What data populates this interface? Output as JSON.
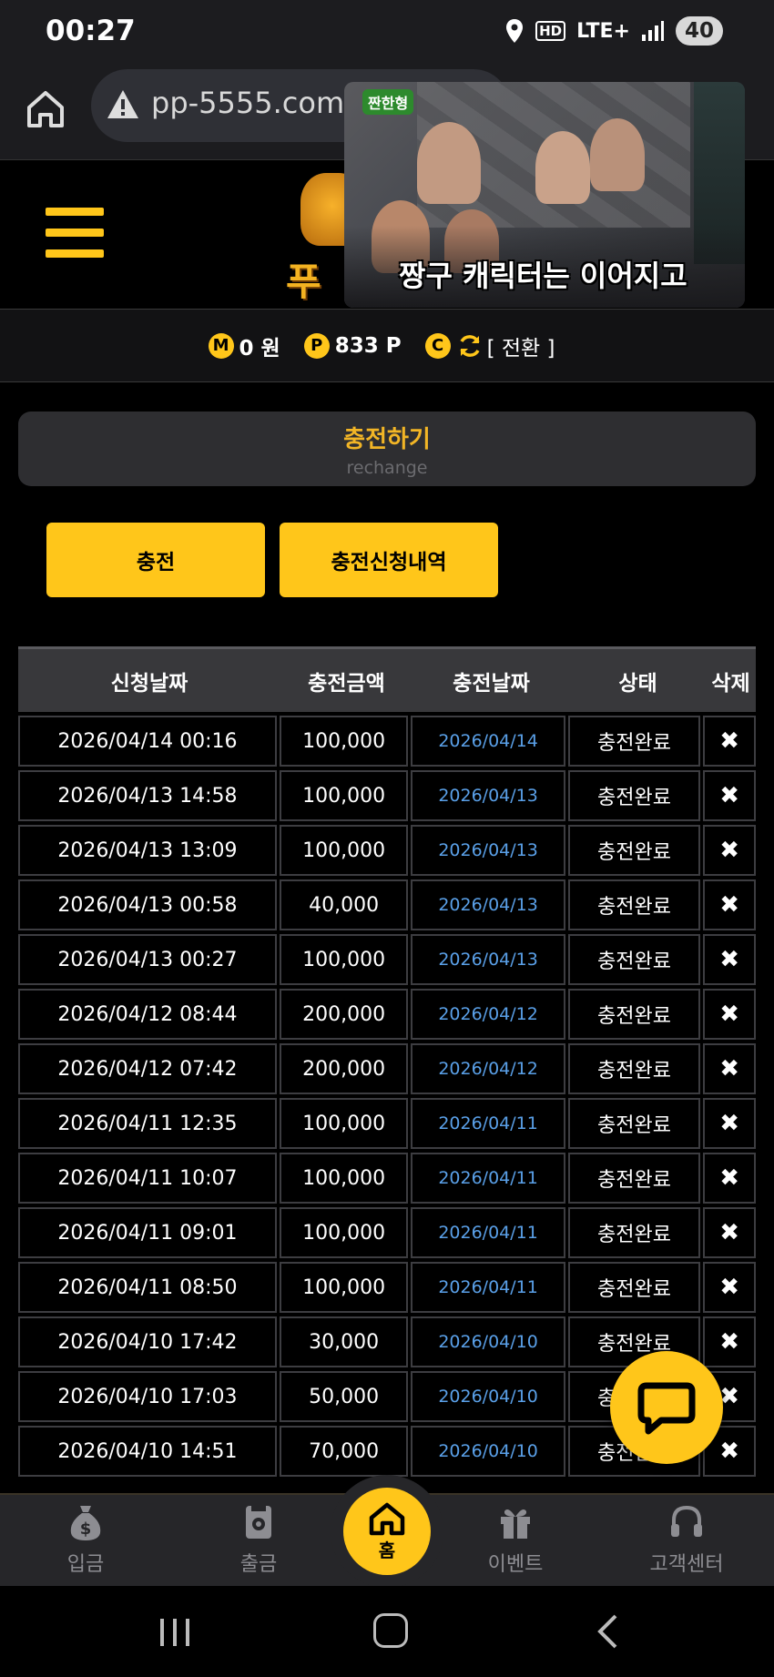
{
  "statusbar": {
    "time": "00:27",
    "network": "LTE+",
    "battery": "40"
  },
  "browser": {
    "url": "pp-5555.com/c"
  },
  "video": {
    "badge": "짠한형",
    "caption": "짱구 캐릭터는 이어지고"
  },
  "logo": {
    "text": "푸우"
  },
  "balance": {
    "money_icon": "M",
    "money": "0 원",
    "point_icon": "P",
    "points": "833 P",
    "coupon_icon": "C",
    "convert_label": "[ 전환 ]"
  },
  "section": {
    "title": "충전하기",
    "subtitle": "rechange"
  },
  "buttons": {
    "charge": "충전",
    "history": "충전신청내역"
  },
  "table": {
    "headers": [
      "신청날짜",
      "충전금액",
      "충전날짜",
      "상태",
      "삭제"
    ],
    "rows": [
      [
        "2026/04/14 00:16",
        "100,000",
        "2026/04/14",
        "충전완료",
        "✖"
      ],
      [
        "2026/04/13 14:58",
        "100,000",
        "2026/04/13",
        "충전완료",
        "✖"
      ],
      [
        "2026/04/13 13:09",
        "100,000",
        "2026/04/13",
        "충전완료",
        "✖"
      ],
      [
        "2026/04/13 00:58",
        "40,000",
        "2026/04/13",
        "충전완료",
        "✖"
      ],
      [
        "2026/04/13 00:27",
        "100,000",
        "2026/04/13",
        "충전완료",
        "✖"
      ],
      [
        "2026/04/12 08:44",
        "200,000",
        "2026/04/12",
        "충전완료",
        "✖"
      ],
      [
        "2026/04/12 07:42",
        "200,000",
        "2026/04/12",
        "충전완료",
        "✖"
      ],
      [
        "2026/04/11 12:35",
        "100,000",
        "2026/04/11",
        "충전완료",
        "✖"
      ],
      [
        "2026/04/11 10:07",
        "100,000",
        "2026/04/11",
        "충전완료",
        "✖"
      ],
      [
        "2026/04/11 09:01",
        "100,000",
        "2026/04/11",
        "충전완료",
        "✖"
      ],
      [
        "2026/04/11 08:50",
        "100,000",
        "2026/04/11",
        "충전완료",
        "✖"
      ],
      [
        "2026/04/10 17:42",
        "30,000",
        "2026/04/10",
        "충전완료",
        "✖"
      ],
      [
        "2026/04/10 17:03",
        "50,000",
        "2026/04/10",
        "충전완료",
        "✖"
      ],
      [
        "2026/04/10 14:51",
        "70,000",
        "2026/04/10",
        "충전완료",
        "✖"
      ]
    ]
  },
  "bottomnav": {
    "deposit": "입금",
    "withdraw": "출금",
    "home": "홈",
    "event": "이벤트",
    "support": "고객센터"
  },
  "colors": {
    "accent": "#ffc61a",
    "link_date": "#5aa0e8",
    "background": "#000000"
  }
}
